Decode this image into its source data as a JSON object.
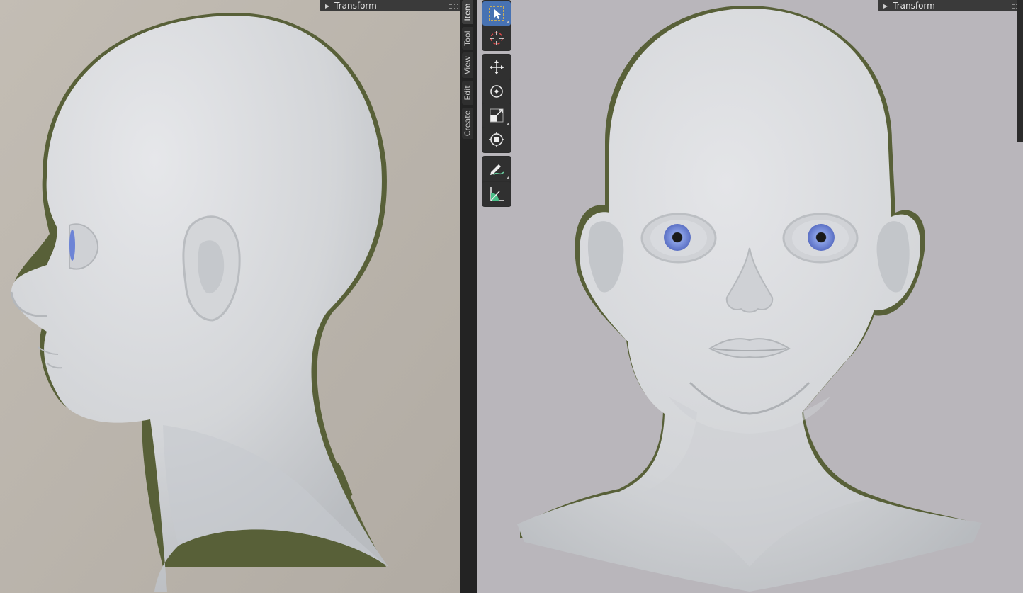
{
  "viewports": {
    "left": {
      "panel_title": "Transform"
    },
    "right": {
      "panel_title": "Transform"
    }
  },
  "sidebar_tabs": {
    "left": [
      {
        "label": "Item",
        "active": true
      },
      {
        "label": "Tool"
      },
      {
        "label": "View"
      },
      {
        "label": "Edit"
      },
      {
        "label": "Create"
      }
    ]
  },
  "toolbar": {
    "tools": [
      {
        "name": "select-box",
        "icon": "select-box-icon",
        "active": true
      },
      {
        "name": "cursor",
        "icon": "cursor-icon"
      },
      {
        "name": "move",
        "icon": "move-icon"
      },
      {
        "name": "rotate",
        "icon": "rotate-icon"
      },
      {
        "name": "scale",
        "icon": "scale-icon"
      },
      {
        "name": "transform",
        "icon": "transform-icon"
      },
      {
        "name": "annotate",
        "icon": "annotate-icon"
      },
      {
        "name": "measure",
        "icon": "measure-icon"
      }
    ]
  },
  "colors": {
    "accent_active_tool": "#4772b3",
    "panel_header_bg": "#3a3a3a",
    "viewport_bg_left": "#b9b3ab",
    "viewport_bg_right": "#b8b5b9",
    "model_surface": "#d9dadc",
    "iris": "#6d84d6"
  }
}
